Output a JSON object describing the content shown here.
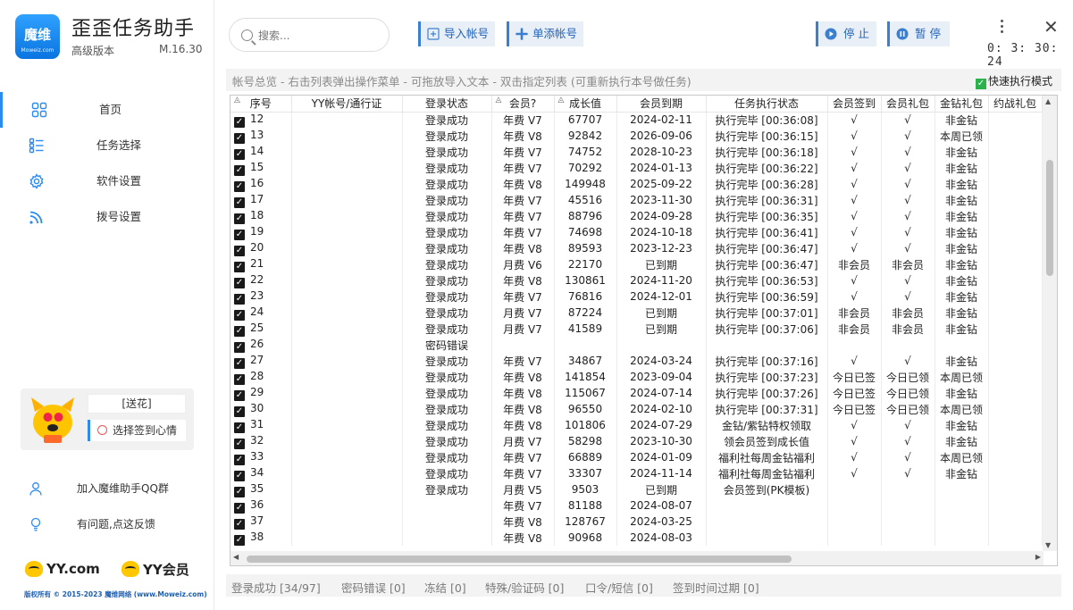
{
  "app": {
    "title": "歪歪任务助手",
    "edition": "高级版本",
    "version": "M.16.30",
    "logo_text": "魔维",
    "logo_sub": "Moweiz.com"
  },
  "nav": [
    {
      "label": "首页",
      "icon": "grid-icon"
    },
    {
      "label": "任务选择",
      "icon": "list-icon"
    },
    {
      "label": "软件设置",
      "icon": "gear-icon"
    },
    {
      "label": "拨号设置",
      "icon": "signal-icon"
    }
  ],
  "promo": {
    "gift_label": "[送花]",
    "checkin_label": "选择签到心情"
  },
  "links": {
    "qq_group": "加入魔维助手QQ群",
    "feedback": "有问题,点这反馈"
  },
  "brands": {
    "yy_com": "YY.com",
    "yy_vip": "YY会员"
  },
  "copyright": "版权所有 © 2015-2023 魔维网络 (www.Moweiz.com)",
  "toolbar": {
    "search_placeholder": "搜索...",
    "import_label": "导入帐号",
    "add_label": "单添帐号",
    "stop_label": "停 止",
    "pause_label": "暂 停"
  },
  "timer": "0: 3: 30: 24",
  "infobar_text": "帐号总览 - 右击列表弹出操作菜单 - 可拖放导入文本 - 双击指定列表 (可重新执行本号做任务)",
  "quick_mode_label": "快速执行模式",
  "table": {
    "headers": [
      "序号",
      "YY帐号/通行证",
      "登录状态",
      "会员?",
      "成长值",
      "会员到期",
      "任务执行状态",
      "会员签到",
      "会员礼包",
      "金钻礼包",
      "约战礼包"
    ],
    "rows": [
      [
        "12",
        "",
        "登录成功",
        "年费 V7",
        "67707",
        "2024-02-11",
        "执行完毕 [00:36:08]",
        "√",
        "√",
        "非金钻",
        ""
      ],
      [
        "13",
        "",
        "登录成功",
        "年费 V8",
        "92842",
        "2026-09-06",
        "执行完毕 [00:36:15]",
        "√",
        "√",
        "本周已领",
        ""
      ],
      [
        "14",
        "",
        "登录成功",
        "年费 V7",
        "74752",
        "2028-10-23",
        "执行完毕 [00:36:18]",
        "√",
        "√",
        "非金钻",
        ""
      ],
      [
        "15",
        "",
        "登录成功",
        "年费 V7",
        "70292",
        "2024-01-13",
        "执行完毕 [00:36:22]",
        "√",
        "√",
        "非金钻",
        ""
      ],
      [
        "16",
        "",
        "登录成功",
        "年费 V8",
        "149948",
        "2025-09-22",
        "执行完毕 [00:36:28]",
        "√",
        "√",
        "非金钻",
        ""
      ],
      [
        "17",
        "",
        "登录成功",
        "年费 V7",
        "45516",
        "2023-11-30",
        "执行完毕 [00:36:31]",
        "√",
        "√",
        "非金钻",
        ""
      ],
      [
        "18",
        "",
        "登录成功",
        "年费 V7",
        "88796",
        "2024-09-28",
        "执行完毕 [00:36:35]",
        "√",
        "√",
        "非金钻",
        ""
      ],
      [
        "19",
        "",
        "登录成功",
        "年费 V7",
        "74698",
        "2024-10-18",
        "执行完毕 [00:36:41]",
        "√",
        "√",
        "非金钻",
        ""
      ],
      [
        "20",
        "",
        "登录成功",
        "年费 V8",
        "89593",
        "2023-12-23",
        "执行完毕 [00:36:47]",
        "√",
        "√",
        "非金钻",
        ""
      ],
      [
        "21",
        "",
        "登录成功",
        "月费 V6",
        "22170",
        "已到期",
        "执行完毕 [00:36:47]",
        "非会员",
        "非会员",
        "非金钻",
        ""
      ],
      [
        "22",
        "",
        "登录成功",
        "年费 V8",
        "130861",
        "2024-11-20",
        "执行完毕 [00:36:53]",
        "√",
        "√",
        "非金钻",
        ""
      ],
      [
        "23",
        "",
        "登录成功",
        "年费 V7",
        "76816",
        "2024-12-01",
        "执行完毕 [00:36:59]",
        "√",
        "√",
        "非金钻",
        ""
      ],
      [
        "24",
        "",
        "登录成功",
        "月费 V7",
        "87224",
        "已到期",
        "执行完毕 [00:37:01]",
        "非会员",
        "非会员",
        "非金钻",
        ""
      ],
      [
        "25",
        "",
        "登录成功",
        "月费 V7",
        "41589",
        "已到期",
        "执行完毕 [00:37:06]",
        "非会员",
        "非会员",
        "非金钻",
        ""
      ],
      [
        "26",
        "",
        "密码错误",
        "",
        "",
        "",
        "",
        "",
        "",
        "",
        ""
      ],
      [
        "27",
        "",
        "登录成功",
        "年费 V7",
        "34867",
        "2024-03-24",
        "执行完毕 [00:37:16]",
        "√",
        "√",
        "非金钻",
        ""
      ],
      [
        "28",
        "",
        "登录成功",
        "年费 V8",
        "141854",
        "2023-09-04",
        "执行完毕 [00:37:23]",
        "今日已签",
        "今日已领",
        "本周已领",
        ""
      ],
      [
        "29",
        "",
        "登录成功",
        "年费 V8",
        "115067",
        "2024-07-14",
        "执行完毕 [00:37:26]",
        "今日已签",
        "今日已领",
        "非金钻",
        ""
      ],
      [
        "30",
        "",
        "登录成功",
        "年费 V8",
        "96550",
        "2024-02-10",
        "执行完毕 [00:37:31]",
        "今日已签",
        "今日已领",
        "本周已领",
        ""
      ],
      [
        "31",
        "",
        "登录成功",
        "年费 V8",
        "101806",
        "2024-07-29",
        "金钻/紫钻特权领取",
        "√",
        "√",
        "非金钻",
        ""
      ],
      [
        "32",
        "",
        "登录成功",
        "月费 V7",
        "58298",
        "2023-10-30",
        "领会员签到成长值",
        "√",
        "√",
        "非金钻",
        ""
      ],
      [
        "33",
        "",
        "登录成功",
        "年费 V7",
        "66889",
        "2024-01-09",
        "福利社每周金钻福利",
        "√",
        "√",
        "本周已领",
        ""
      ],
      [
        "34",
        "",
        "登录成功",
        "年费 V7",
        "33307",
        "2024-11-14",
        "福利社每周金钻福利",
        "√",
        "√",
        "非金钻",
        ""
      ],
      [
        "35",
        "",
        "登录成功",
        "月费 V5",
        "9503",
        "已到期",
        "会员签到(PK模板)",
        "",
        "",
        "",
        ""
      ],
      [
        "36",
        "",
        "",
        "年费 V7",
        "81188",
        "2024-08-07",
        "",
        "",
        "",
        "",
        ""
      ],
      [
        "37",
        "",
        "",
        "年费 V8",
        "128767",
        "2024-03-25",
        "",
        "",
        "",
        "",
        ""
      ],
      [
        "38",
        "",
        "",
        "年费 V8",
        "90968",
        "2024-08-03",
        "",
        "",
        "",
        "",
        ""
      ]
    ]
  },
  "status": {
    "success": "登录成功 [34/97]",
    "pwd_error": "密码错误 [0]",
    "frozen": "冻结 [0]",
    "special": "特殊/验证码 [0]",
    "token": "口令/短信 [0]",
    "checkin_expired": "签到时间过期 [0]"
  }
}
